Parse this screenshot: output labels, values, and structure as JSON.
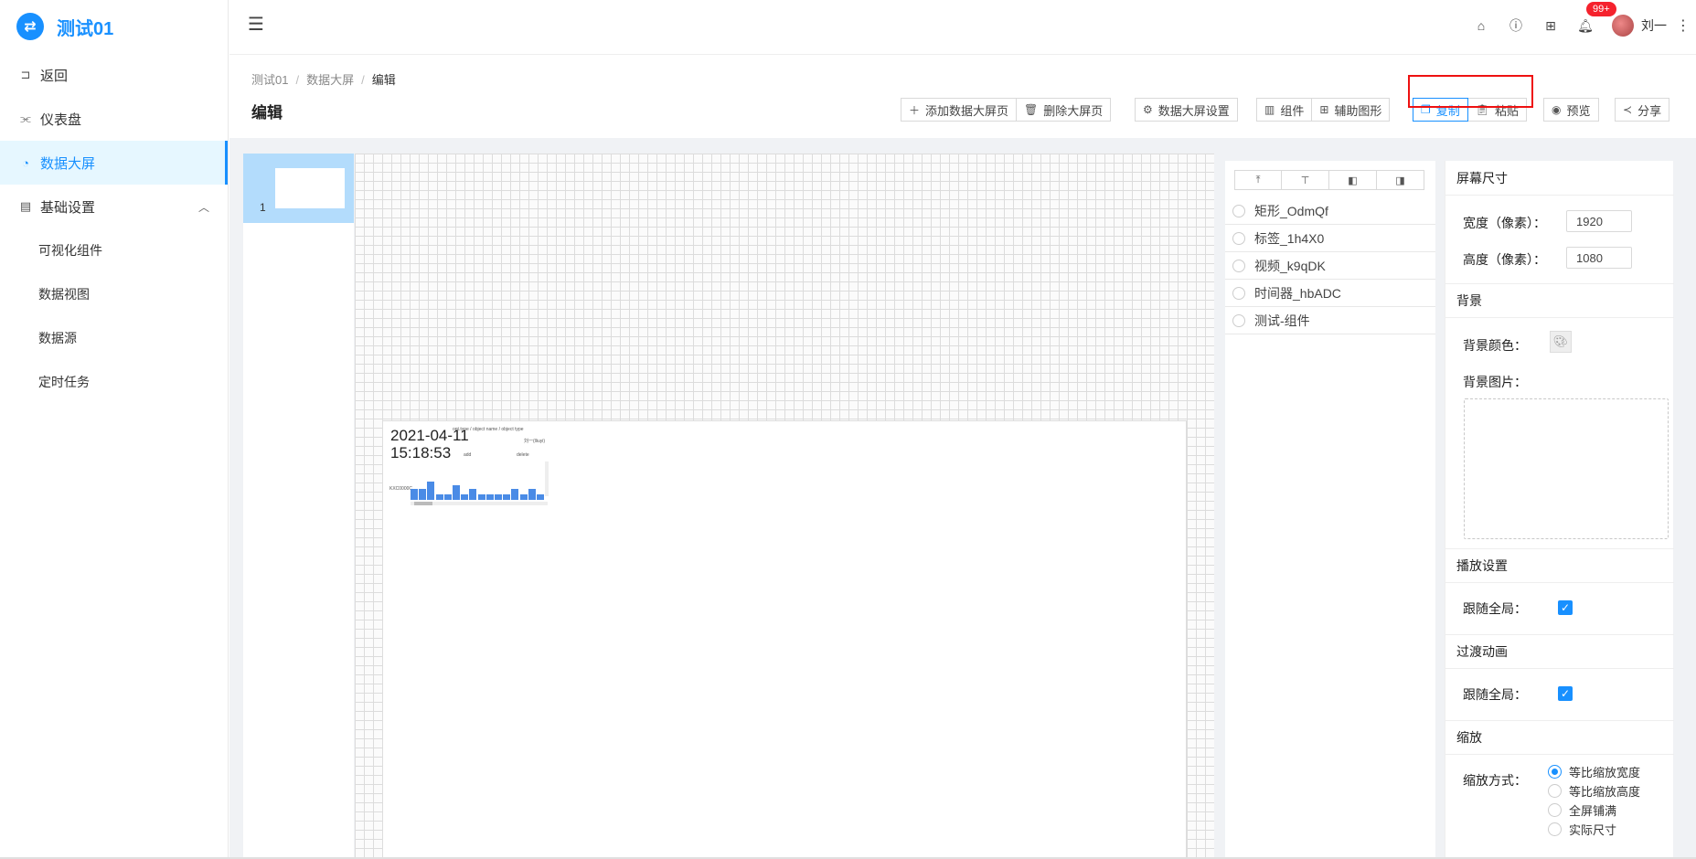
{
  "app": {
    "logo_text": "测试01"
  },
  "sidebar": {
    "items": [
      {
        "label": "返回",
        "icon": "return-icon",
        "glyph": "⊐"
      },
      {
        "label": "仪表盘",
        "icon": "dashboard-icon",
        "glyph": "⫘"
      },
      {
        "label": "数据大屏",
        "icon": "pie-chart-icon",
        "glyph": "◔"
      },
      {
        "label": "基础设置",
        "icon": "document-icon",
        "glyph": "▤"
      }
    ],
    "subitems": [
      "可视化组件",
      "数据视图",
      "数据源",
      "定时任务"
    ]
  },
  "header": {
    "notification_count": "99+",
    "username": "刘一",
    "accent": "#1890ff"
  },
  "breadcrumb": [
    "测试01",
    "数据大屏",
    "编辑"
  ],
  "page_title": "编辑",
  "toolbar": {
    "add_page": "添加数据大屏页",
    "delete_page": "删除大屏页",
    "screen_settings": "数据大屏设置",
    "components": "组件",
    "aux_shapes": "辅助图形",
    "copy": "复制",
    "paste": "粘贴",
    "preview": "预览",
    "share": "分享"
  },
  "pages": [
    {
      "num": "1"
    }
  ],
  "canvas": {
    "clock_text": "2021-04-11 15:18:53",
    "mini_chart": {
      "title": "opt.type / object name / object type",
      "legend": "刘一(lliuyi)",
      "captions": [
        "add",
        "delete"
      ],
      "ylabel": "KXC0000C",
      "bar_values": [
        6,
        6,
        10,
        3,
        3,
        8,
        3,
        6,
        3,
        3,
        3,
        3,
        6,
        3,
        6,
        3
      ]
    }
  },
  "layers": [
    "矩形_OdmQf",
    "标签_1h4X0",
    "视频_k9qDK",
    "时间器_hbADC",
    "测试-组件"
  ],
  "props": {
    "screen_size_title": "屏幕尺寸",
    "width_label": "宽度（像素）：",
    "width_value": "1920",
    "height_label": "高度（像素）：",
    "height_value": "1080",
    "background_title": "背景",
    "bg_color_label": "背景颜色：",
    "bg_image_label": "背景图片：",
    "playback_title": "播放设置",
    "follow_global_label": "跟随全局：",
    "transition_title": "过渡动画",
    "follow_global_label2": "跟随全局：",
    "scale_title": "缩放",
    "scale_mode_label": "缩放方式：",
    "scale_options": [
      "等比缩放宽度",
      "等比缩放高度",
      "全屏铺满",
      "实际尺寸"
    ],
    "scale_selected": 0
  }
}
